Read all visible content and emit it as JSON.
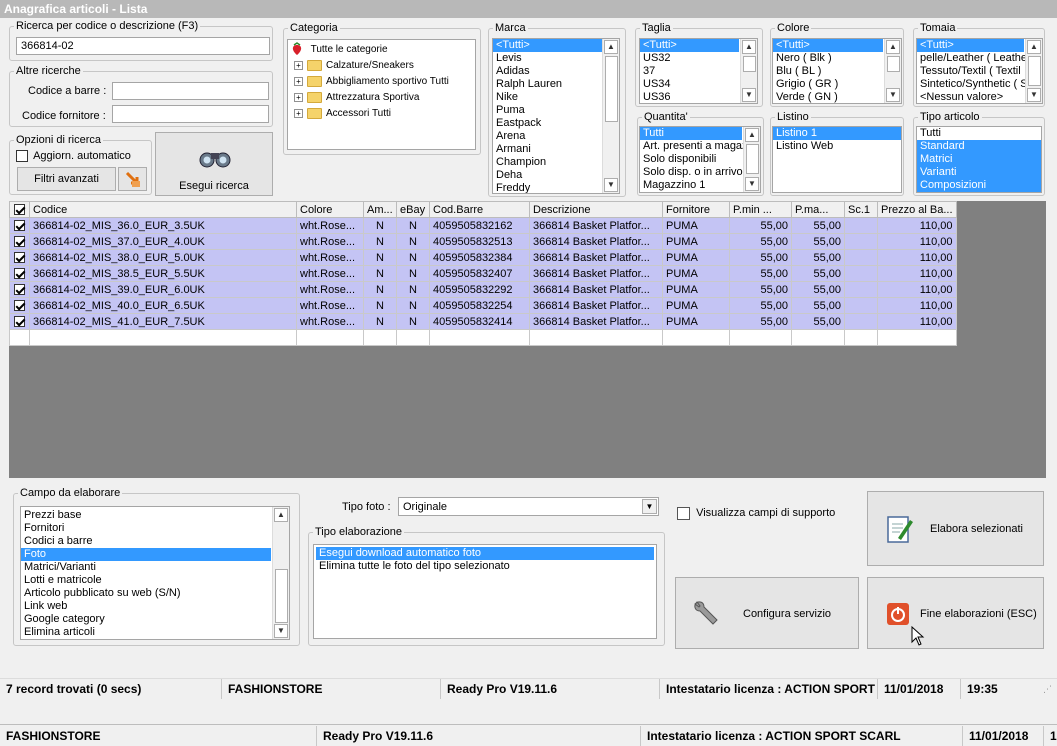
{
  "window": {
    "title": "Anagrafica articoli  - Lista"
  },
  "search": {
    "legend": "Ricerca per codice o descrizione (F3)",
    "value": "366814-02"
  },
  "altre": {
    "legend": "Altre ricerche",
    "barcode_label": "Codice a barre :",
    "barcode_value": "",
    "supplier_label": "Codice fornitore :",
    "supplier_value": ""
  },
  "opzioni": {
    "legend": "Opzioni di ricerca",
    "auto_update_label": "Aggiorn. automatico",
    "advanced_filters_label": "Filtri avanzati",
    "run_search_label": "Esegui ricerca"
  },
  "categoria": {
    "legend": "Categoria",
    "root": "Tutte le categorie",
    "nodes": [
      "Calzature/Sneakers",
      "Abbigliamento sportivo Tutti",
      "Attrezzatura Sportiva",
      "Accessori Tutti"
    ]
  },
  "marca": {
    "legend": "Marca",
    "items": [
      "<Tutti>",
      "Levis",
      "Adidas",
      "Ralph Lauren",
      "Nike",
      "Puma",
      "Eastpack",
      "Arena",
      "Armani",
      "Champion",
      "Deha",
      "Freddy"
    ]
  },
  "taglia": {
    "legend": "Taglia",
    "items": [
      "<Tutti>",
      "US32",
      "37",
      "US34",
      "US36"
    ]
  },
  "colore": {
    "legend": "Colore",
    "items": [
      "<Tutti>",
      "Nero ( Blk )",
      "Blu ( BL )",
      "Grigio ( GR )",
      "Verde ( GN )"
    ]
  },
  "tomaia": {
    "legend": "Tomaia",
    "items": [
      "<Tutti>",
      "pelle/Leather ( Leather",
      "Tessuto/Textil ( Textil",
      "Sintetico/Synthetic ( S",
      "<Nessun valore>"
    ]
  },
  "quantita": {
    "legend": "Quantita'",
    "items": [
      "Tutti",
      "Art. presenti a magazzino",
      "Solo disponibili",
      "Solo disp. o in arrivo",
      "Magazzino 1"
    ]
  },
  "listino": {
    "legend": "Listino",
    "items": [
      "Listino 1",
      "Listino Web"
    ]
  },
  "tipo_articolo": {
    "legend": "Tipo articolo",
    "items": [
      "Tutti",
      "Standard",
      "Matrici",
      "Varianti",
      "Composizioni"
    ]
  },
  "grid": {
    "headers": [
      "Codice",
      "Colore",
      "Am...",
      "eBay",
      "Cod.Barre",
      "Descrizione",
      "Fornitore",
      "P.min ...",
      "P.ma...",
      "Sc.1",
      "Prezzo al Ba..."
    ],
    "rows": [
      [
        "366814-02_MIS_36.0_EUR_3.5UK",
        "wht.Rose...",
        "N",
        "N",
        "4059505832162",
        "366814  Basket Platfor...",
        "PUMA",
        "55,00",
        "55,00",
        "",
        "110,00"
      ],
      [
        "366814-02_MIS_37.0_EUR_4.0UK",
        "wht.Rose...",
        "N",
        "N",
        "4059505832513",
        "366814  Basket Platfor...",
        "PUMA",
        "55,00",
        "55,00",
        "",
        "110,00"
      ],
      [
        "366814-02_MIS_38.0_EUR_5.0UK",
        "wht.Rose...",
        "N",
        "N",
        "4059505832384",
        "366814  Basket Platfor...",
        "PUMA",
        "55,00",
        "55,00",
        "",
        "110,00"
      ],
      [
        "366814-02_MIS_38.5_EUR_5.5UK",
        "wht.Rose...",
        "N",
        "N",
        "4059505832407",
        "366814  Basket Platfor...",
        "PUMA",
        "55,00",
        "55,00",
        "",
        "110,00"
      ],
      [
        "366814-02_MIS_39.0_EUR_6.0UK",
        "wht.Rose...",
        "N",
        "N",
        "4059505832292",
        "366814  Basket Platfor...",
        "PUMA",
        "55,00",
        "55,00",
        "",
        "110,00"
      ],
      [
        "366814-02_MIS_40.0_EUR_6.5UK",
        "wht.Rose...",
        "N",
        "N",
        "4059505832254",
        "366814  Basket Platfor...",
        "PUMA",
        "55,00",
        "55,00",
        "",
        "110,00"
      ],
      [
        "366814-02_MIS_41.0_EUR_7.5UK",
        "wht.Rose...",
        "N",
        "N",
        "4059505832414",
        "366814  Basket Platfor...",
        "PUMA",
        "55,00",
        "55,00",
        "",
        "110,00"
      ]
    ]
  },
  "campo": {
    "legend": "Campo da elaborare",
    "items": [
      "Prezzi base",
      "Fornitori",
      "Codici a barre",
      "Foto",
      "Matrici/Varianti",
      "Lotti e matricole",
      "Articolo pubblicato su web (S/N)",
      "Link web",
      "Google category",
      "Elimina articoli"
    ],
    "selected_index": 3
  },
  "tipo_foto": {
    "label": "Tipo foto :",
    "value": "Originale"
  },
  "tipo_elab": {
    "legend": "Tipo elaborazione",
    "items": [
      "Esegui download automatico foto",
      "Elimina tutte le foto del tipo selezionato"
    ]
  },
  "support_fields_label": "Visualizza campi di supporto",
  "buttons": {
    "elabora": "Elabora selezionati",
    "configura": "Configura servizio",
    "fine": "Fine elaborazioni (ESC)"
  },
  "status1": {
    "records": "7 record trovati (0 secs)",
    "store": "FASHIONSTORE",
    "version": "Ready Pro V19.11.6",
    "license": "Intestatario licenza : ACTION SPORT S",
    "date": "11/01/2018",
    "time": "19:35"
  },
  "status2": {
    "store": "FASHIONSTORE",
    "version": "Ready Pro V19.11.6",
    "license": "Intestatario licenza : ACTION SPORT SCARL",
    "date": "11/01/2018",
    "extra": "1"
  },
  "colors": {
    "selection": "#3399ff",
    "row_highlight": "#c4c4f4",
    "grid_background": "#808080"
  }
}
